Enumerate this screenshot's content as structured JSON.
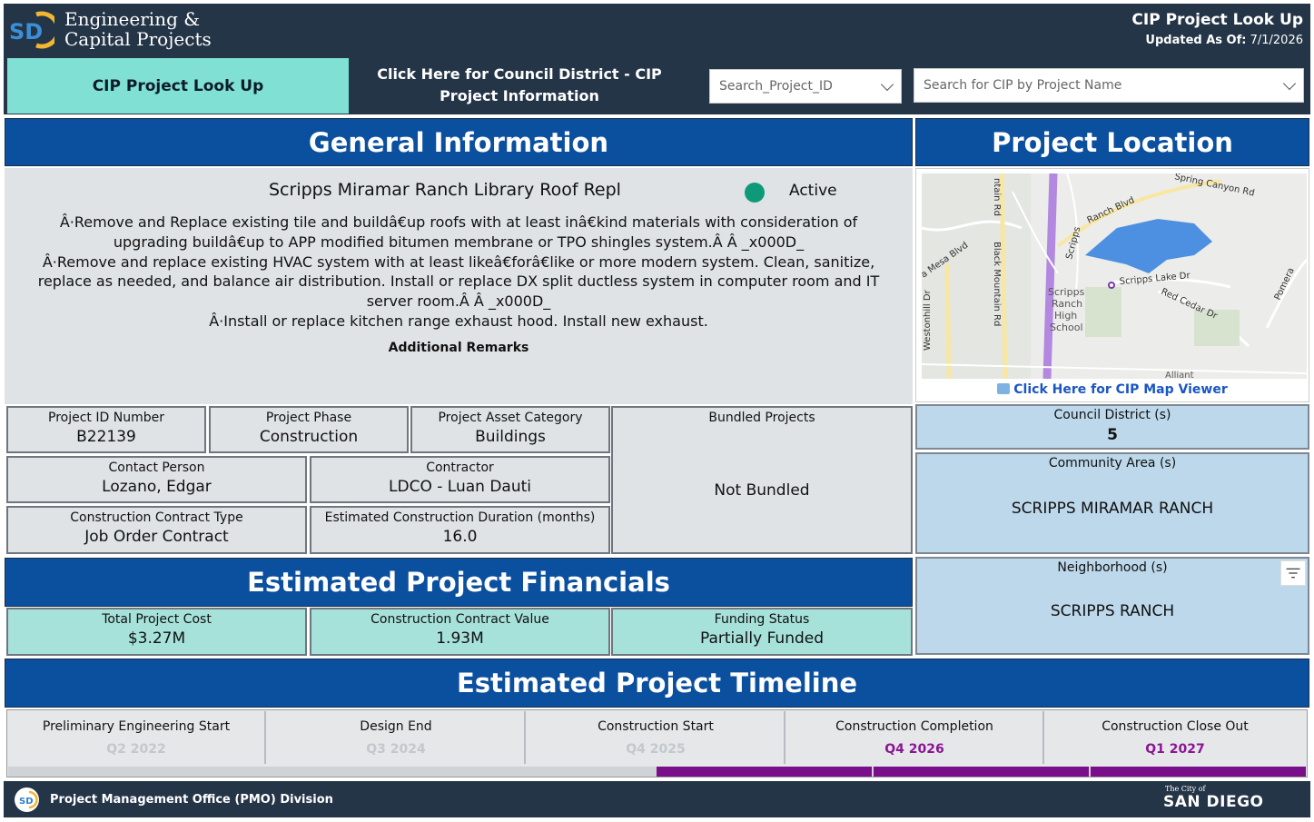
{
  "header": {
    "org_line1": "Engineering &",
    "org_line2": "Capital Projects",
    "title": "CIP Project Look Up",
    "updated_label": "Updated As Of:",
    "updated_value": "7/1/2026"
  },
  "nav": {
    "tab_lookup": "CIP Project Look Up",
    "tab_council": "Click Here for Council District - CIP Project Information"
  },
  "search": {
    "project_id_placeholder": "Search_Project_ID",
    "project_name_placeholder": "Search for CIP by Project Name"
  },
  "sections": {
    "general": "General Information",
    "location": "Project Location",
    "financials": "Estimated Project Financials",
    "timeline": "Estimated Project Timeline"
  },
  "project": {
    "name": "Scripps Miramar Ranch Library Roof Repl",
    "status": "Active",
    "status_color": "#0e9a79",
    "description_lines": [
      "Â·Remove and Replace existing tile and buildâ€up roofs with at least inâ€kind materials with consideration of",
      "upgrading buildâ€up to APP modified bitumen membrane or TPO shingles system.Â Â _x000D_",
      "Â·Remove and replace existing HVAC system with at least likeâ€forâ€like or more modern system. Clean, sanitize,",
      "replace as needed, and balance air distribution. Install or replace DX split ductless system in computer room and IT",
      "server room.Â Â _x000D_",
      "Â·Install or replace kitchen range exhaust hood. Install new exhaust."
    ],
    "remarks_label": "Additional Remarks"
  },
  "cards": {
    "project_id": {
      "label": "Project ID Number",
      "value": "B22139"
    },
    "phase": {
      "label": "Project Phase",
      "value": "Construction"
    },
    "asset": {
      "label": "Project Asset Category",
      "value": "Buildings"
    },
    "bundled": {
      "label": "Bundled Projects",
      "value": "Not Bundled"
    },
    "contact": {
      "label": "Contact Person",
      "value": "Lozano, Edgar"
    },
    "contractor": {
      "label": "Contractor",
      "value": "LDCO - Luan Dauti"
    },
    "contract_type": {
      "label": "Construction Contract Type",
      "value": "Job Order Contract"
    },
    "duration": {
      "label": "Estimated Construction Duration (months)",
      "value": "16.0"
    }
  },
  "financials": {
    "total": {
      "label": "Total Project Cost",
      "value": "$3.27M"
    },
    "contract_value": {
      "label": "Construction Contract Value",
      "value": "1.93M"
    },
    "funding": {
      "label": "Funding Status",
      "value": "Partially Funded"
    }
  },
  "location": {
    "map_link": "Click Here for CIP Map Viewer",
    "map_labels": {
      "road1": "ntain Rd",
      "road2": "Black Mountain Rd",
      "road3": "Westonhill Dr",
      "road4": "a Mesa Blvd",
      "road5": "Scripps",
      "road6": "Ranch Blvd",
      "road7": "Spring Canyon Rd",
      "road8": "Scripps Lake Dr",
      "road9": "Red Cedar Dr",
      "road10": "Pomera",
      "place1": "Scripps",
      "place2": "Ranch",
      "place3": "High",
      "place4": "School",
      "road11": "Alliant"
    },
    "council": {
      "label": "Council District (s)",
      "value": "5"
    },
    "community": {
      "label": "Community Area (s)",
      "value": "SCRIPPS MIRAMAR RANCH"
    },
    "neighborhood": {
      "label": "Neighborhood (s)",
      "value": "SCRIPPS RANCH"
    }
  },
  "timeline": [
    {
      "label": "Preliminary Engineering Start",
      "value": "Q2 2022"
    },
    {
      "label": "Design End",
      "value": "Q3 2024"
    },
    {
      "label": "Construction Start",
      "value": "Q4 2025"
    },
    {
      "label": "Construction Completion",
      "value": "Q4 2026"
    },
    {
      "label": "Construction Close Out",
      "value": "Q1 2027"
    }
  ],
  "footer": {
    "division": "Project Management Office (PMO) Division",
    "city_small": "The City of",
    "city": "SAN DIEGO"
  },
  "colors": {
    "navy": "#243547",
    "banner_blue": "#0b4f9f",
    "teal": "#7fe0d3",
    "timeline_purple": "#7a0f8c"
  }
}
